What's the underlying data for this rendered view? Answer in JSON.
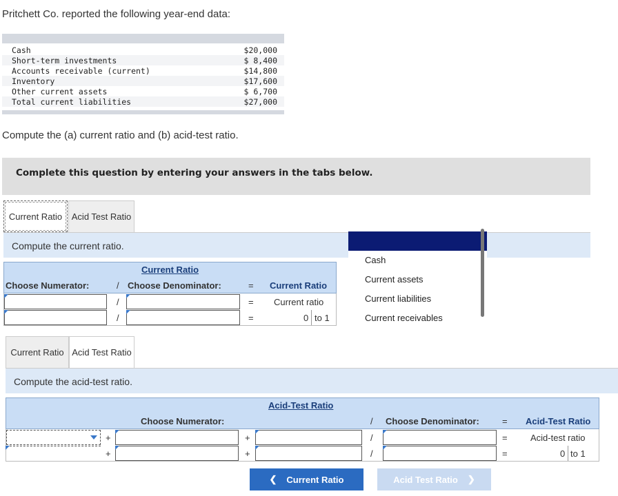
{
  "intro": "Pritchett Co. reported the following year-end data:",
  "data_rows": [
    {
      "label": "Cash",
      "value": "$20,000"
    },
    {
      "label": "Short-term investments",
      "value": "$ 8,400"
    },
    {
      "label": "Accounts receivable (current)",
      "value": "$14,800"
    },
    {
      "label": "Inventory",
      "value": "$17,600"
    },
    {
      "label": "Other current assets",
      "value": "$ 6,700"
    },
    {
      "label": "Total current liabilities",
      "value": "$27,000"
    }
  ],
  "compute": "Compute the (a) current ratio and (b) acid-test ratio.",
  "instruction": "Complete this question by entering your answers in the tabs below.",
  "tabs": {
    "current": "Current Ratio",
    "acid": "Acid Test Ratio"
  },
  "current_section": {
    "prompt": "Compute the current ratio.",
    "title": "Current Ratio",
    "numerator_label": "Choose Numerator:",
    "denominator_label": "Choose Denominator:",
    "divide": "/",
    "equals": "=",
    "result_label": "Current Ratio",
    "result_row_label": "Current ratio",
    "result_value": "0",
    "to_one": "to 1"
  },
  "dropdown": {
    "options": [
      "Cash",
      "Current assets",
      "Current liabilities",
      "Current receivables"
    ]
  },
  "acid_section": {
    "prompt": "Compute the acid-test ratio.",
    "title": "Acid-Test Ratio",
    "numerator_label": "Choose Numerator:",
    "denominator_label": "Choose Denominator:",
    "plus": "+",
    "divide": "/",
    "equals": "=",
    "result_label": "Acid-Test Ratio",
    "result_row_label": "Acid-test ratio",
    "result_value": "0",
    "to_one": "to 1"
  },
  "nav": {
    "prev": "Current Ratio",
    "next": "Acid Test Ratio"
  },
  "colors": {
    "accent": "#2b6bc1",
    "header": "#c9ddf5",
    "banner": "#dde9f7",
    "dropdown_highlight": "#0b1b73"
  }
}
